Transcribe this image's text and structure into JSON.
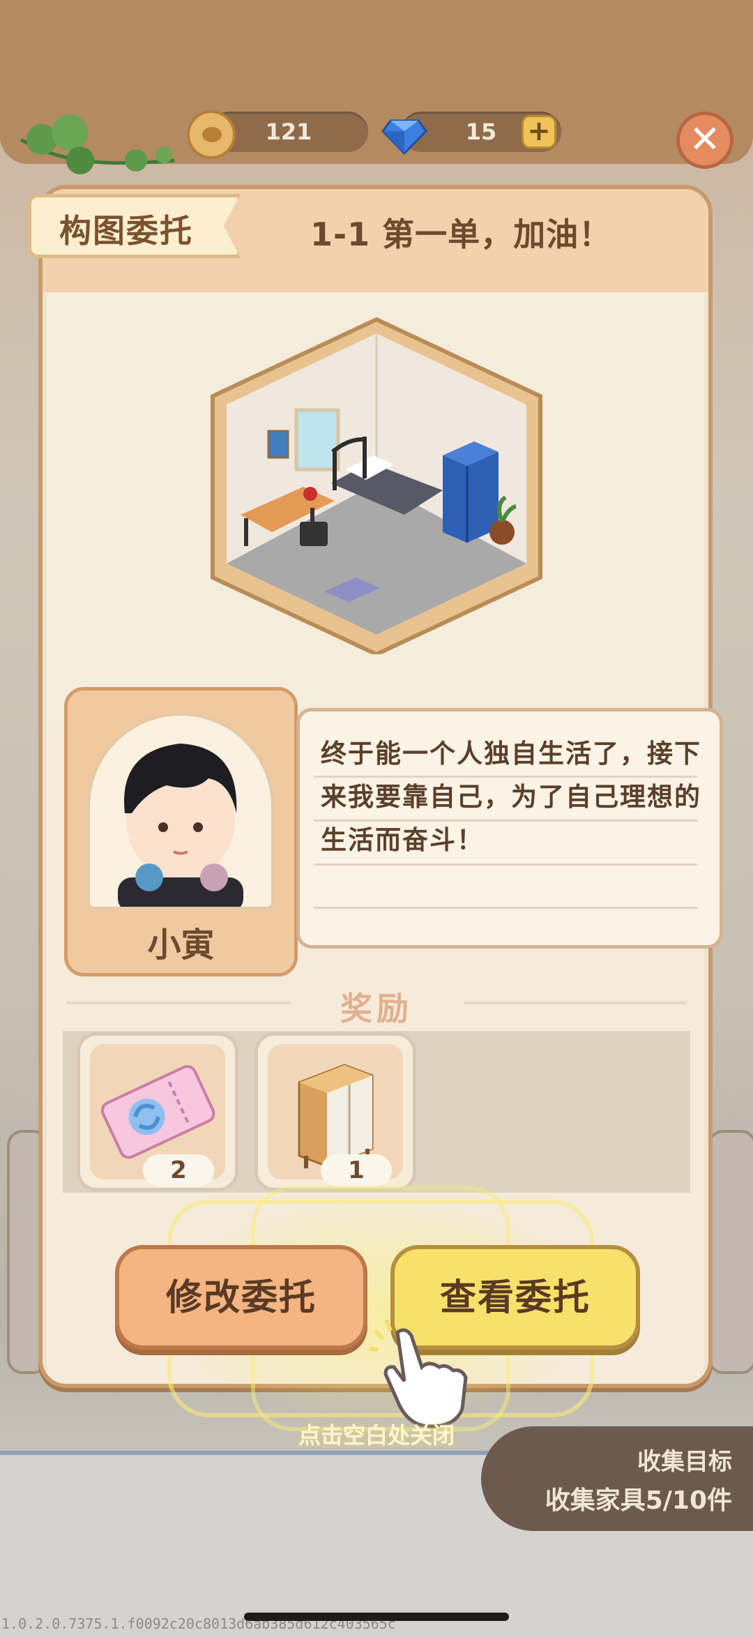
{
  "resources": {
    "coins": "121",
    "gems": "15"
  },
  "panel": {
    "tag": "构图委托",
    "title": "1-1 第一单，加油！",
    "character_name": "小寅",
    "dialog": "终于能一个人独自生活了，接下来我要靠自己，为了自己理想的生活而奋斗！"
  },
  "rewards": {
    "title": "奖励",
    "items": [
      {
        "icon": "ticket-icon",
        "count": "2"
      },
      {
        "icon": "cabinet-icon",
        "count": "1"
      }
    ]
  },
  "buttons": {
    "modify": "修改委托",
    "view": "查看委托"
  },
  "hint": "点击空白处关闭",
  "goal": {
    "title": "收集目标",
    "desc": "收集家具5/10件"
  },
  "version": "1.0.2.0.7375.1.f0092c20c8013d6ab385d612c403565c",
  "colors": {
    "accent": "#f7e16a",
    "panel": "#efe4cf",
    "border": "#c99a6b"
  }
}
